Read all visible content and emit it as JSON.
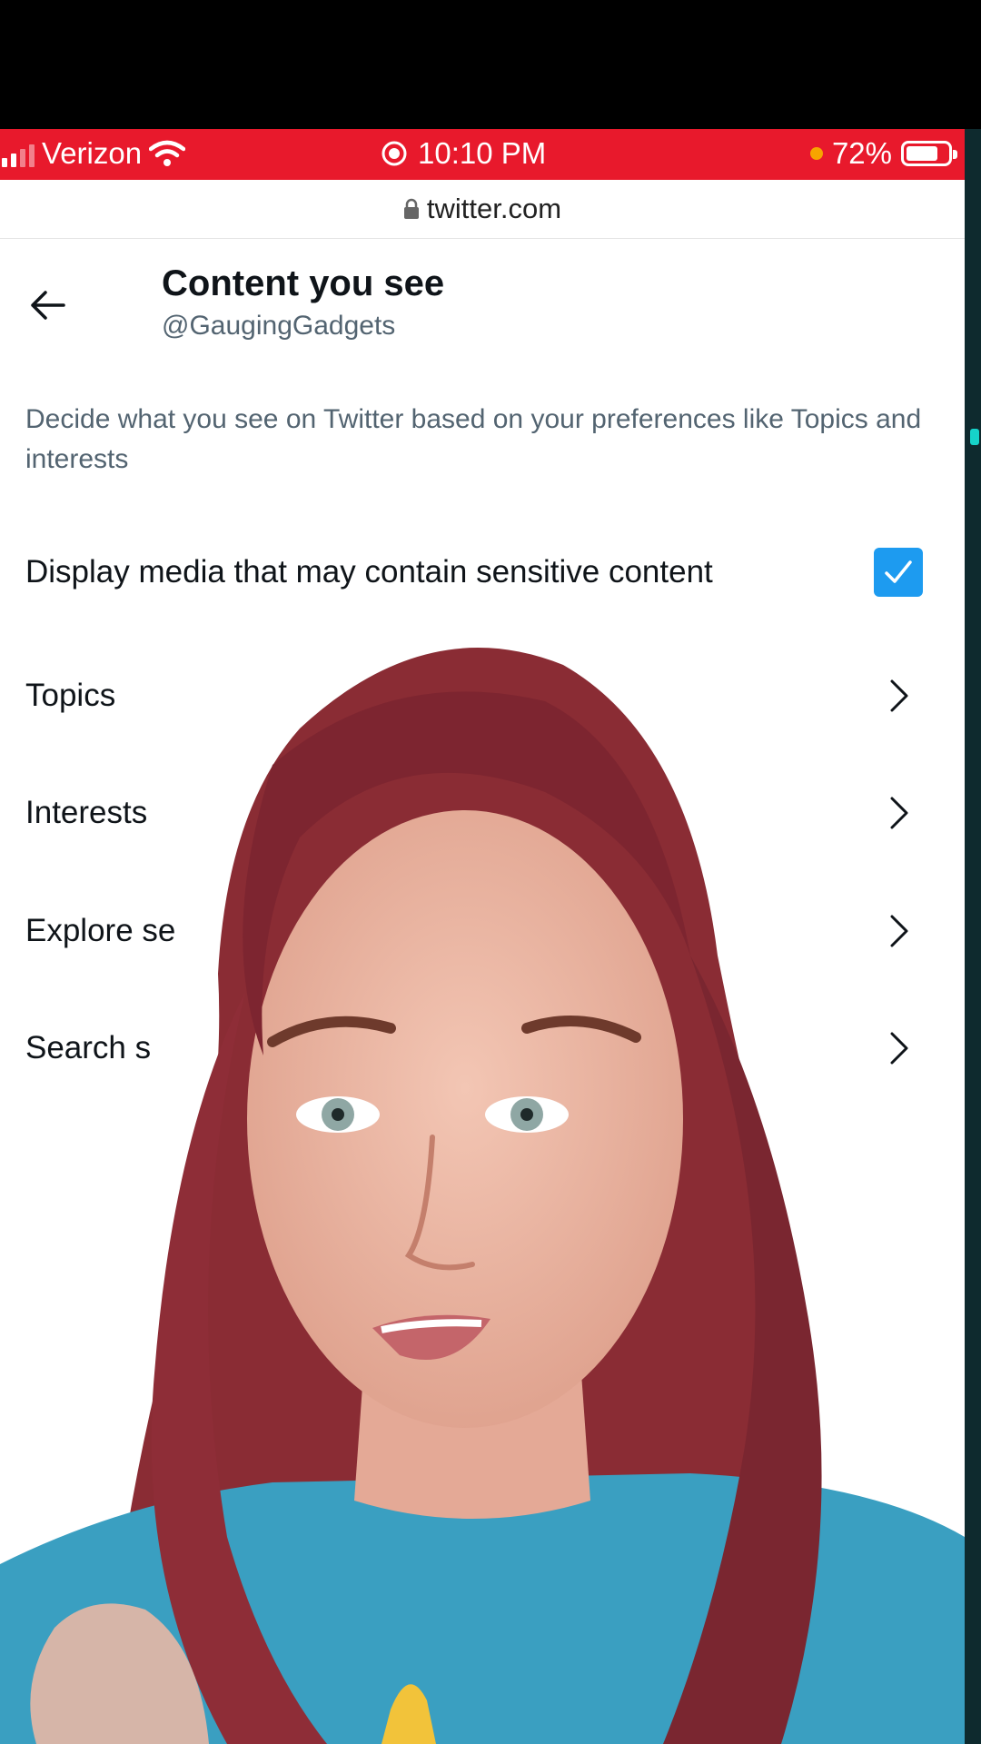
{
  "status_bar": {
    "carrier": "Verizon",
    "time": "10:10 PM",
    "battery": "72%",
    "battery_level": 0.72,
    "background_color": "#e8192c",
    "icons": [
      "signal-icon",
      "wifi-icon",
      "screen-record-icon",
      "orange-dot-icon",
      "battery-icon"
    ]
  },
  "browser": {
    "url": "twitter.com",
    "lock_icon": "lock-icon"
  },
  "header": {
    "back_icon": "back-arrow-icon",
    "title": "Content you see",
    "handle": "@GaugingGadgets"
  },
  "description": "Decide what you see on Twitter based on your preferences like Topics and interests",
  "settings": {
    "sensitive_media": {
      "label": "Display media that may contain sensitive content",
      "checked": true,
      "check_color": "#1d9bf0"
    },
    "items": [
      {
        "label": "Topics"
      },
      {
        "label": "Interests"
      },
      {
        "label": "Explore se"
      },
      {
        "label": "Search s"
      }
    ],
    "chevron_icon": "chevron-right-icon"
  },
  "colors": {
    "text_primary": "#0f1419",
    "text_secondary": "#536471",
    "accent": "#1d9bf0"
  }
}
